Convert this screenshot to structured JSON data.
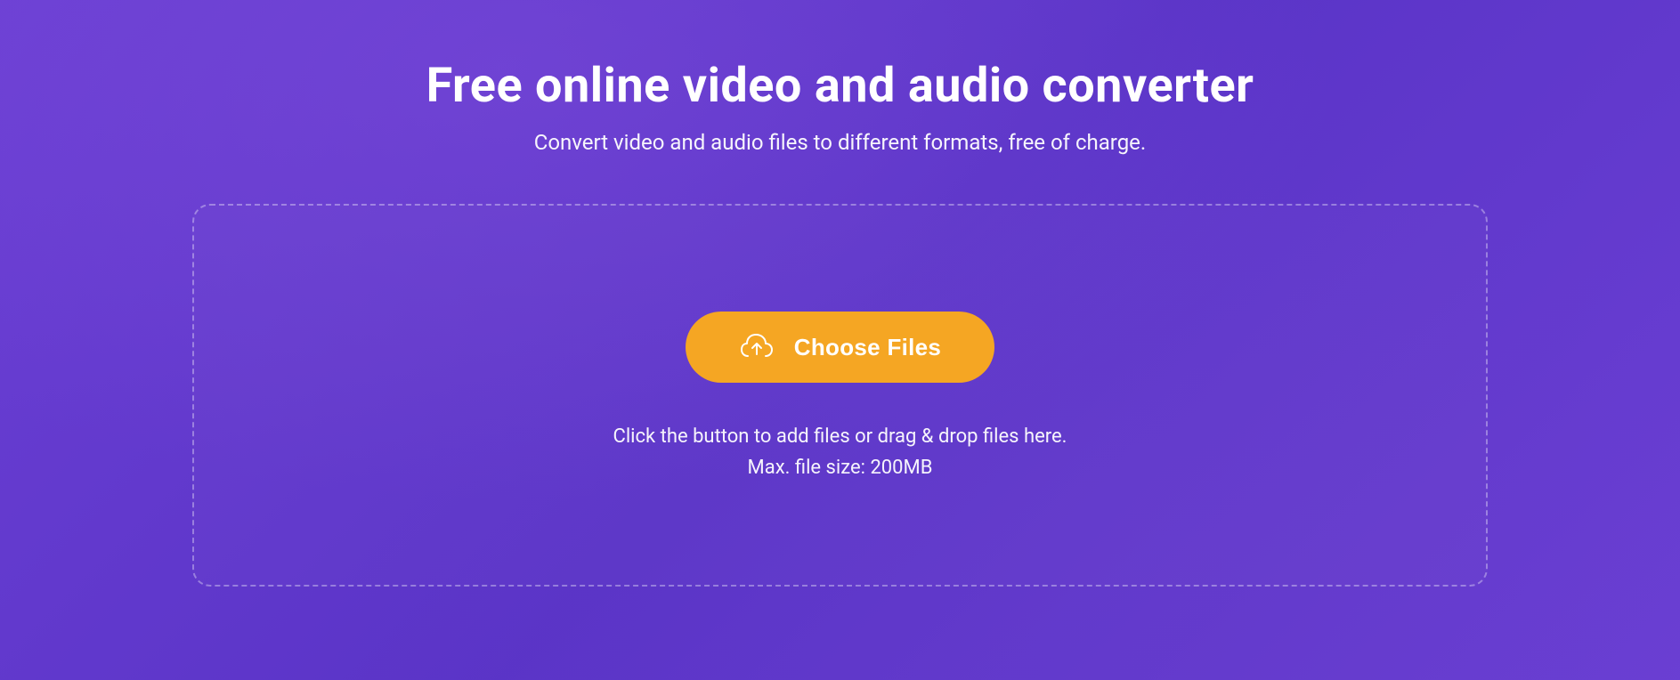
{
  "header": {
    "title": "Free online video and audio converter",
    "subtitle": "Convert video and audio files to different formats, free of charge."
  },
  "dropzone": {
    "button_label": "Choose Files",
    "hint": "Click the button to add files or drag & drop files here.",
    "max_size": "Max. file size: 200MB"
  }
}
